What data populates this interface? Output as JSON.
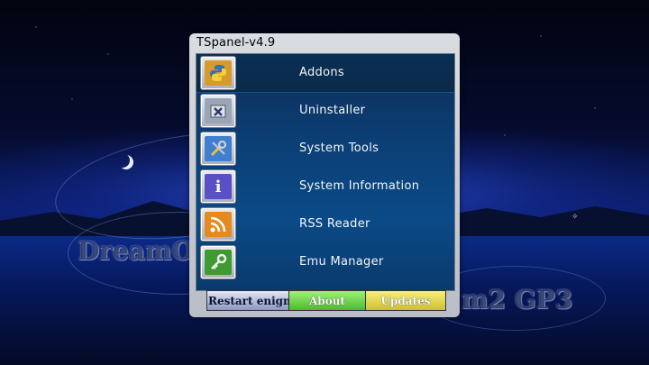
{
  "panel": {
    "title": "TSpanel-v4.9",
    "selected_index": 0,
    "items": [
      {
        "label": "Addons",
        "icon": "python-icon",
        "color": "#d89a2a",
        "glyph": "🐍"
      },
      {
        "label": "Uninstaller",
        "icon": "uninstall-icon",
        "color": "#9aa6b8",
        "glyph": "✖"
      },
      {
        "label": "System Tools",
        "icon": "tools-icon",
        "color": "#3e7fd0",
        "glyph": "🔧"
      },
      {
        "label": "System Information",
        "icon": "info-icon",
        "color": "#5b4fc7",
        "glyph": "i"
      },
      {
        "label": "RSS Reader",
        "icon": "rss-icon",
        "color": "#e58a1f",
        "glyph": "))"
      },
      {
        "label": "Emu Manager",
        "icon": "key-icon",
        "color": "#3f9a32",
        "glyph": "⚷"
      }
    ]
  },
  "buttons": {
    "restart_label": "Restart enigma",
    "about_label": "About",
    "updates_label": "Updates"
  },
  "background": {
    "brand_left": "DreamOE",
    "brand_right": "m2 GP3"
  }
}
